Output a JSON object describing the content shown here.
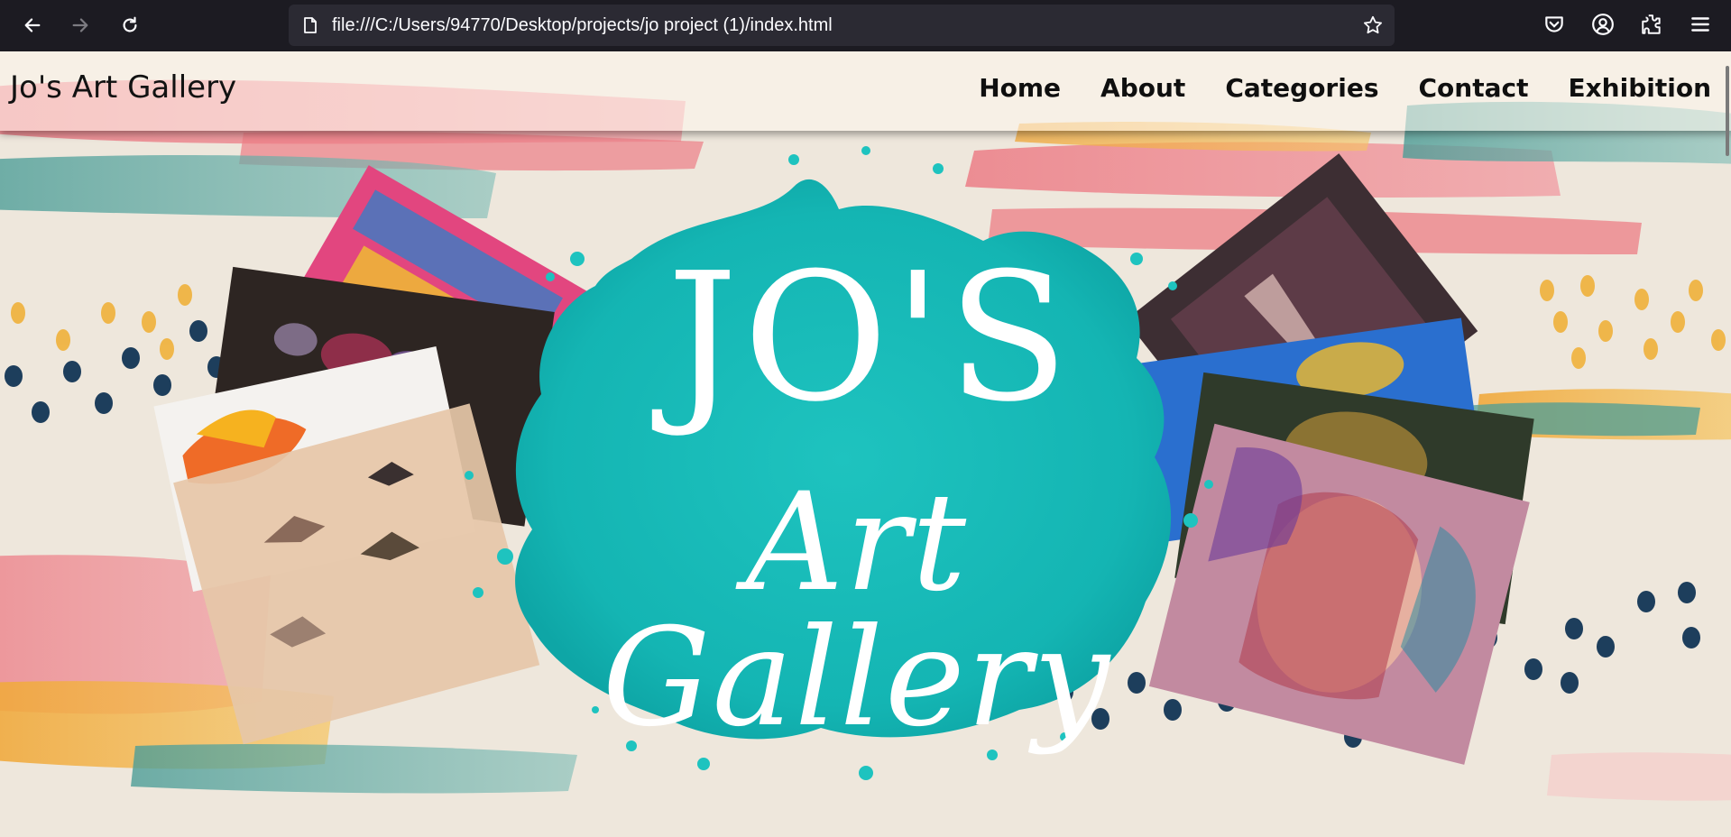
{
  "browser": {
    "url": "file:///C:/Users/94770/Desktop/projects/jo project (1)/index.html",
    "back_icon": "arrow-left-icon",
    "forward_icon": "arrow-right-icon",
    "reload_icon": "reload-icon",
    "page_icon": "document-icon",
    "bookmark_icon": "star-icon",
    "toolbar_icons": [
      "pocket-icon",
      "account-icon",
      "extensions-icon",
      "menu-icon"
    ]
  },
  "site": {
    "logo": "Jo's Art Gallery",
    "nav": [
      "Home",
      "About",
      "Categories",
      "Contact",
      "Exhibition"
    ]
  },
  "hero": {
    "title_top": "JO'S",
    "title_bottom": "Art Gallery",
    "colors": {
      "splash": "#1fc1bd",
      "pink_stroke": "#ec7d86",
      "teal_stroke": "#5aa8a2",
      "yellow_stroke": "#f0b13b",
      "navy_dots": "#1d3e5c"
    }
  }
}
